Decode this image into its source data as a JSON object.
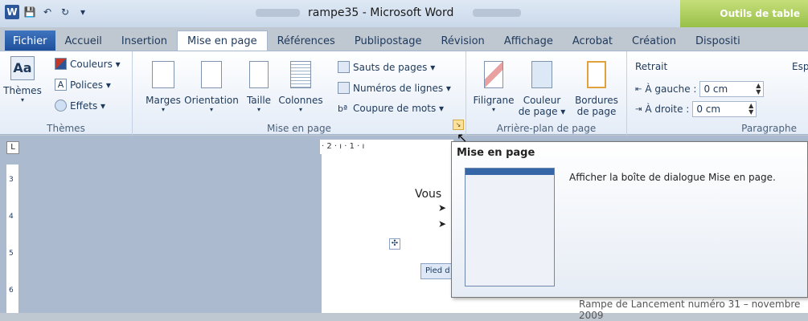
{
  "window": {
    "title": "rampe35 - Microsoft Word",
    "context_tab_group": "Outils de table"
  },
  "tabs": [
    "Fichier",
    "Accueil",
    "Insertion",
    "Mise en page",
    "Références",
    "Publipostage",
    "Révision",
    "Affichage",
    "Acrobat",
    "Création",
    "Dispositi"
  ],
  "active_tab": "Mise en page",
  "ribbon": {
    "themes": {
      "group_label": "Thèmes",
      "themes_btn": "Thèmes",
      "couleurs": "Couleurs ▾",
      "polices": "Polices ▾",
      "effets": "Effets ▾"
    },
    "mise_en_page": {
      "group_label": "Mise en page",
      "marges": "Marges",
      "orientation": "Orientation",
      "taille": "Taille",
      "colonnes": "Colonnes",
      "sauts": "Sauts de pages ▾",
      "numeros": "Numéros de lignes ▾",
      "coupure": "Coupure de mots ▾"
    },
    "arriere_plan": {
      "group_label": "Arrière-plan de page",
      "filigrane": "Filigrane",
      "couleur_l1": "Couleur",
      "couleur_l2": "de page ▾",
      "bordures_l1": "Bordures",
      "bordures_l2": "de page"
    },
    "paragraphe": {
      "group_label": "Paragraphe",
      "retrait": "Retrait",
      "gauche_label": "À gauche :",
      "gauche_value": "0 cm",
      "droite_label": "À droite :",
      "droite_value": "0 cm",
      "espacement": "Esp"
    }
  },
  "ruler": {
    "horizontal": "· 2 · ı · 1 · ı",
    "vertical": [
      "3",
      "4",
      "5",
      "6"
    ]
  },
  "document": {
    "text_vous": "Vous",
    "footer_tag": "Pied d",
    "footer_text": "Rampe de Lancement numéro 31 – novembre 2009"
  },
  "tooltip": {
    "title": "Mise en page",
    "description": "Afficher la boîte de dialogue Mise en page."
  }
}
